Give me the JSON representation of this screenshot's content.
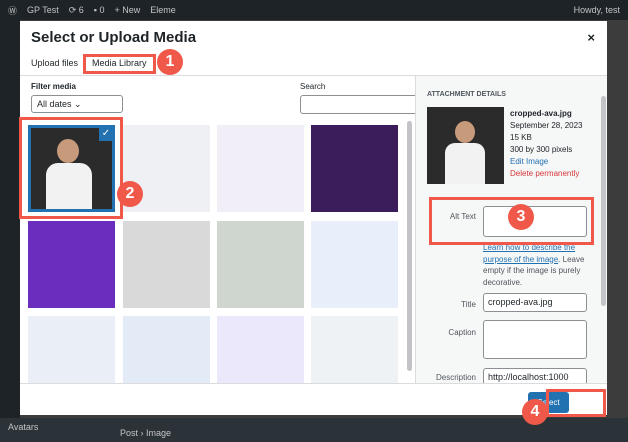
{
  "admin_bar": {
    "site": "GP Test",
    "updates": "6",
    "comments": "0",
    "new": "+ New",
    "eleme": "Eleme",
    "howdy": "Howdy, test"
  },
  "modal": {
    "title": "Select or Upload Media",
    "close": "×",
    "tabs": [
      "Upload files",
      "Media Library"
    ],
    "filter_label": "Filter media",
    "filter_value": "All dates ⌄",
    "search_label": "Search",
    "thumbs": [
      {
        "color": "#2b2b2b"
      },
      {
        "color": "#eef0f4"
      },
      {
        "color": "#f2eef8"
      },
      {
        "color": "#3b1d5c"
      },
      {
        "color": "#6a2dbd"
      },
      {
        "color": "#d9d9d9"
      },
      {
        "color": "#cfd6d0"
      },
      {
        "color": "#e8eefa"
      },
      {
        "color": "#e9eef7"
      },
      {
        "color": "#e3ecf6"
      },
      {
        "color": "#ece8fb"
      },
      {
        "color": "#eef2f5"
      }
    ],
    "details": {
      "heading": "ATTACHMENT DETAILS",
      "filename": "cropped-ava.jpg",
      "date": "September 28, 2023",
      "size": "15 KB",
      "dimensions": "300 by 300 pixels",
      "edit": "Edit Image",
      "delete": "Delete permanently",
      "alt_label": "Alt Text",
      "alt_value": "",
      "alt_link": "Learn how to describe the purpose of the image",
      "alt_help": ". Leave empty if the image is purely decorative.",
      "title_label": "Title",
      "title_value": "cropped-ava.jpg",
      "caption_label": "Caption",
      "caption_value": "",
      "description_label": "Description",
      "description_value": "http://localhost:1000"
    },
    "select_button": "Select"
  },
  "bottom": {
    "avatars": "Avatars",
    "breadcrumb": "Post  ›  Image"
  },
  "annotations": [
    "1",
    "2",
    "3",
    "4"
  ],
  "colors": {
    "accent": "#2271b1",
    "annotation": "#f0594a",
    "delete": "#d63638"
  }
}
